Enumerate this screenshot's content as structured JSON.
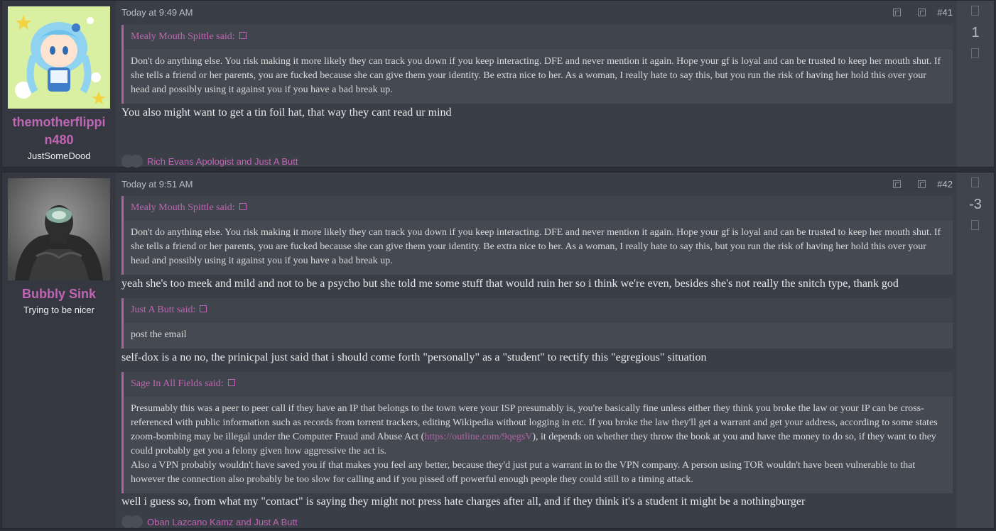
{
  "posts": [
    {
      "username": "themotherflippin480",
      "username_line1": "themotherflippi",
      "username_line2": "n480",
      "user_title": "JustSomeDood",
      "date": "Today at 9:49 AM",
      "number": "#41",
      "score": "1",
      "quote": {
        "author": "Mealy Mouth Spittle said:",
        "text": "Don't do anything else. You risk making it more likely they can track you down if you keep interacting. DFE and never mention it again. Hope your gf is loyal and can be trusted to keep her mouth shut. If she tells a friend or her parents, you are fucked because she can give them your identity. Be extra nice to her. As a woman, I really hate to say this, but you run the risk of having her hold this over your head and possibly using it against you if you have a bad break up."
      },
      "body": "You also might want to get a tin foil hat, that way they cant read ur mind",
      "reactions": "Rich Evans Apologist and Just A Butt"
    },
    {
      "username": "Bubbly Sink",
      "user_title": "Trying to be nicer",
      "date": "Today at 9:51 AM",
      "number": "#42",
      "score": "-3",
      "quote1": {
        "author": "Mealy Mouth Spittle said:",
        "text": "Don't do anything else. You risk making it more likely they can track you down if you keep interacting. DFE and never mention it again. Hope your gf is loyal and can be trusted to keep her mouth shut. If she tells a friend or her parents, you are fucked because she can give them your identity. Be extra nice to her. As a woman, I really hate to say this, but you run the risk of having her hold this over your head and possibly using it against you if you have a bad break up."
      },
      "text1": "yeah she's too meek and mild and not to be a psycho but she told me some stuff that would ruin her so i think we're even, besides she's not really the snitch type, thank god",
      "quote2": {
        "author": "Just A Butt said:",
        "text": "post the email"
      },
      "text2": "self-dox is a no no, the prinicpal just said that i should come forth \"personally\" as a \"student\" to rectify this \"egregious\" situation",
      "quote3": {
        "author": "Sage In All Fields said:",
        "text_a": "Presumably this was a peer to peer call if they have an IP that belongs to the town were your ISP presumably is, you're basically fine unless either they think you broke the law or your IP can be cross-referenced with public information such as records from torrent trackers, editing Wikipedia without logging in etc. If you broke the law they'll get a warrant and get your address, according to some states zoom-bombing may be illegal under the Computer Fraud and Abuse Act (",
        "link": "https://outline.com/9qegsV",
        "text_b": "), it depends on whether they throw the book at you and have the money to do so, if they want to they could probably get you a felony given how aggressive the act is.",
        "text_c": "Also a VPN probably wouldn't have saved you if that makes you feel any better, because they'd just put a warrant in to the VPN company. A person using TOR wouldn't have been vulnerable to that however the connection also probably be too slow for calling and if you pissed off powerful enough people they could still to a timing attack."
      },
      "text3": "well i guess so, from what my \"contact\" is saying they might not press hate charges after all, and if they think it's a student it might be a nothingburger",
      "reactions": "Oban Lazcano Kamz and Just A Butt"
    }
  ],
  "colors": {
    "accent": "#c065b3",
    "background": "#3a3e47",
    "quote_bg": "#454952"
  },
  "icons": [
    "report-icon",
    "bookmark-icon",
    "quote-icon",
    "upvote-icon",
    "downvote-icon"
  ]
}
